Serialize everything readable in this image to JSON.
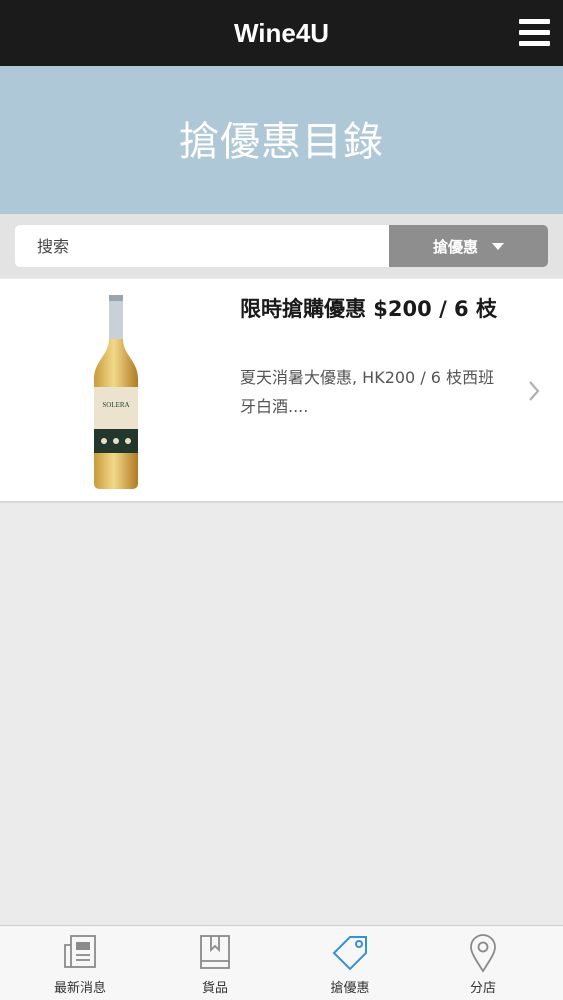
{
  "header": {
    "app_title": "Wine4U",
    "menu_icon": "hamburger-menu-icon"
  },
  "banner": {
    "title": "搶優惠目錄"
  },
  "search": {
    "placeholder": "搜索",
    "value": "",
    "filter_label": "搶優惠",
    "filter_icon": "caret-down-icon"
  },
  "list": {
    "items": [
      {
        "title": "限時搶購優惠 $200 / 6 枝",
        "description": "夏天消暑大優惠, HK200 / 6 枝西班牙白酒....",
        "image": "wine-bottle-image",
        "bottle_label": "SOLERA"
      }
    ]
  },
  "tabs": [
    {
      "label": "最新消息",
      "icon": "newspaper-icon"
    },
    {
      "label": "貨品",
      "icon": "book-icon"
    },
    {
      "label": "搶優惠",
      "icon": "price-tag-icon",
      "active": true
    },
    {
      "label": "分店",
      "icon": "map-pin-icon"
    }
  ],
  "colors": {
    "topbar": "#1c1b1c",
    "banner": "#afc8d8",
    "active_tab": "#3a8fd6",
    "inactive_tab": "#8a8a8a"
  }
}
